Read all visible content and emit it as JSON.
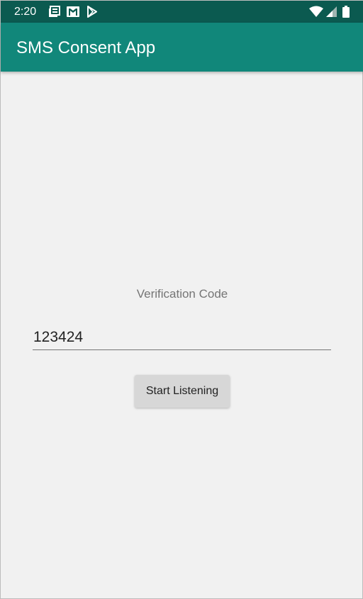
{
  "status_bar": {
    "time": "2:20",
    "notification_icons": [
      "news-icon",
      "gmail-icon",
      "play-store-icon"
    ],
    "system_icons": [
      "wifi-icon",
      "cell-signal-icon",
      "battery-icon"
    ],
    "background": "#0b5a50"
  },
  "app_bar": {
    "title": "SMS Consent App",
    "background": "#11877a"
  },
  "main": {
    "label": "Verification Code",
    "code_input": {
      "value": "123424",
      "placeholder": ""
    },
    "start_button_label": "Start Listening"
  }
}
